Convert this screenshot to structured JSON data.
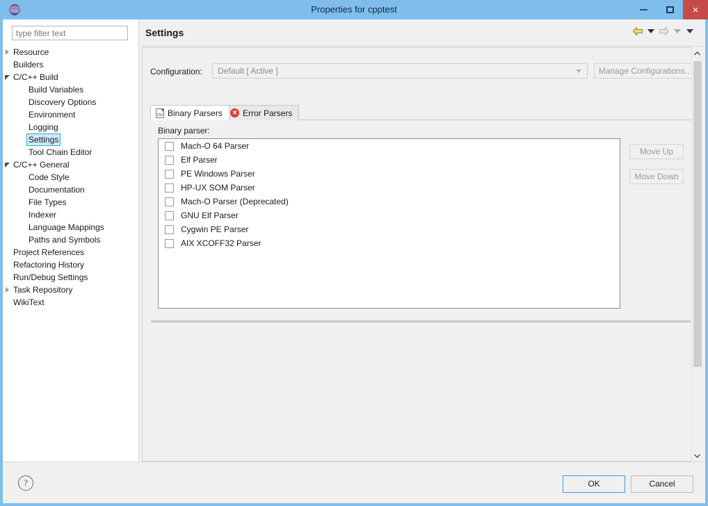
{
  "window": {
    "title": "Properties for cpptest",
    "app_icon": "eclipse-globe-icon",
    "minimize_label": "–",
    "maximize_label": "□",
    "close_label": "×"
  },
  "sidebar": {
    "filter": {
      "value": "",
      "placeholder": "type filter text"
    },
    "items": [
      {
        "label": "Resource",
        "indent": 0,
        "twisty": "collapsed",
        "selected": false
      },
      {
        "label": "Builders",
        "indent": 0,
        "twisty": "none",
        "selected": false
      },
      {
        "label": "C/C++ Build",
        "indent": 0,
        "twisty": "expanded",
        "selected": false
      },
      {
        "label": "Build Variables",
        "indent": 1,
        "twisty": "none",
        "selected": false
      },
      {
        "label": "Discovery Options",
        "indent": 1,
        "twisty": "none",
        "selected": false
      },
      {
        "label": "Environment",
        "indent": 1,
        "twisty": "none",
        "selected": false
      },
      {
        "label": "Logging",
        "indent": 1,
        "twisty": "none",
        "selected": false
      },
      {
        "label": "Settings",
        "indent": 1,
        "twisty": "none",
        "selected": true
      },
      {
        "label": "Tool Chain Editor",
        "indent": 1,
        "twisty": "none",
        "selected": false
      },
      {
        "label": "C/C++ General",
        "indent": 0,
        "twisty": "expanded",
        "selected": false
      },
      {
        "label": "Code Style",
        "indent": 1,
        "twisty": "none",
        "selected": false
      },
      {
        "label": "Documentation",
        "indent": 1,
        "twisty": "none",
        "selected": false
      },
      {
        "label": "File Types",
        "indent": 1,
        "twisty": "none",
        "selected": false
      },
      {
        "label": "Indexer",
        "indent": 1,
        "twisty": "none",
        "selected": false
      },
      {
        "label": "Language Mappings",
        "indent": 1,
        "twisty": "none",
        "selected": false
      },
      {
        "label": "Paths and Symbols",
        "indent": 1,
        "twisty": "none",
        "selected": false
      },
      {
        "label": "Project References",
        "indent": 0,
        "twisty": "none",
        "selected": false
      },
      {
        "label": "Refactoring History",
        "indent": 0,
        "twisty": "none",
        "selected": false
      },
      {
        "label": "Run/Debug Settings",
        "indent": 0,
        "twisty": "none",
        "selected": false
      },
      {
        "label": "Task Repository",
        "indent": 0,
        "twisty": "collapsed",
        "selected": false
      },
      {
        "label": "WikiText",
        "indent": 0,
        "twisty": "none",
        "selected": false
      }
    ]
  },
  "page": {
    "title": "Settings",
    "nav": {
      "back_icon": "back-arrow-icon",
      "back_menu_icon": "chevron-down-icon",
      "forward_icon": "forward-arrow-icon",
      "forward_menu_icon": "chevron-down-icon",
      "view_menu_icon": "chevron-down-icon"
    }
  },
  "configuration": {
    "label": "Configuration:",
    "selected": "Default  [ Active ]",
    "manage_button": "Manage Configurations..",
    "dropdown_icon": "chevron-down-icon"
  },
  "tabs": [
    {
      "label": "Binary Parsers",
      "icon": "binary-file-icon",
      "icon_text": "010",
      "active": true
    },
    {
      "label": "Error Parsers",
      "icon": "error-circle-icon",
      "icon_text": "✕",
      "active": false
    }
  ],
  "binary_parsers": {
    "group_label": "Binary parser:",
    "items": [
      {
        "label": "Mach-O 64 Parser",
        "checked": false
      },
      {
        "label": "Elf Parser",
        "checked": false
      },
      {
        "label": "PE Windows Parser",
        "checked": false
      },
      {
        "label": "HP-UX SOM Parser",
        "checked": false
      },
      {
        "label": "Mach-O Parser (Deprecated)",
        "checked": false
      },
      {
        "label": "GNU Elf Parser",
        "checked": false
      },
      {
        "label": "Cygwin PE Parser",
        "checked": false
      },
      {
        "label": "AIX XCOFF32 Parser",
        "checked": false
      }
    ],
    "move_up": "Move Up",
    "move_down": "Move Down"
  },
  "scrollbars": {
    "vertical": {
      "up_icon": "▲",
      "down_icon": "▼"
    },
    "horizontal": {
      "left_icon": "❮",
      "right_icon": "❯"
    }
  },
  "footer": {
    "help_icon": "?",
    "ok": "OK",
    "cancel": "Cancel"
  },
  "colors": {
    "titlebar": "#7fbded",
    "close_button": "#c74a4a",
    "selection_fill": "#cfe9f7",
    "selection_border": "#2eaddc",
    "focus_border": "#3b9ae1",
    "error_icon": "#d93b3b",
    "panel_bg": "#f0f0f0"
  }
}
